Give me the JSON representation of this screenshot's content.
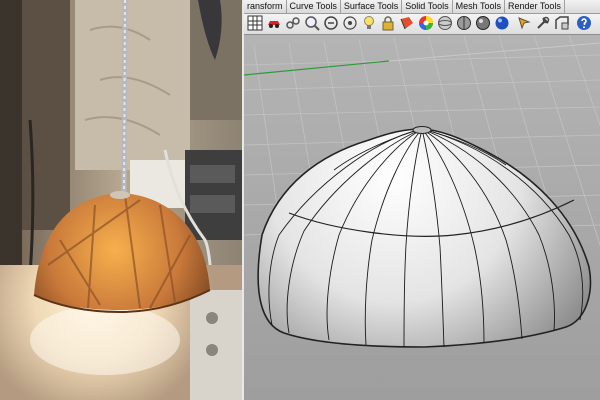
{
  "toolbar": {
    "tabs": [
      {
        "name": "tab-transform",
        "label": "ransform"
      },
      {
        "name": "tab-curve-tools",
        "label": "Curve Tools"
      },
      {
        "name": "tab-surface-tools",
        "label": "Surface Tools"
      },
      {
        "name": "tab-solid-tools",
        "label": "Solid Tools"
      },
      {
        "name": "tab-mesh-tools",
        "label": "Mesh Tools"
      },
      {
        "name": "tab-render-tools",
        "label": "Render Tools"
      }
    ],
    "icons": [
      {
        "name": "grid-icon"
      },
      {
        "name": "car-icon"
      },
      {
        "name": "link-icon"
      },
      {
        "name": "magnifier-icon"
      },
      {
        "name": "zoom-window-icon"
      },
      {
        "name": "target-icon"
      },
      {
        "name": "lightbulb-icon"
      },
      {
        "name": "lock-icon"
      },
      {
        "name": "layer-icon"
      },
      {
        "name": "color-wheel-icon"
      },
      {
        "name": "sphere-gray-icon"
      },
      {
        "name": "sphere-dark-icon"
      },
      {
        "name": "shaded-sphere-icon"
      },
      {
        "name": "blue-sphere-icon"
      },
      {
        "name": "pointer-icon"
      },
      {
        "name": "tools-icon"
      },
      {
        "name": "transform-icon"
      },
      {
        "name": "help-icon"
      }
    ]
  }
}
